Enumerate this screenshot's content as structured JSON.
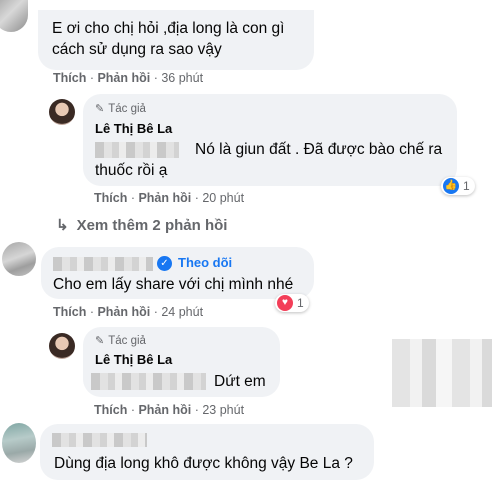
{
  "comment1": {
    "text": "E ơi cho chị hỏi ,địa long là con gì cách sử dụng ra sao vậy",
    "like": "Thích",
    "reply": "Phản hồi",
    "time": "36 phút"
  },
  "reply1": {
    "author_tag": "Tác giả",
    "author_name": "Lê Thị Bê La",
    "text": "Nó là giun đất . Đã được bào chế ra thuốc rồi ạ",
    "like": "Thích",
    "reply": "Phản hồi",
    "time": "20 phút",
    "reaction_count": "1",
    "reaction_icon": "like-icon"
  },
  "more_replies": {
    "label": "Xem thêm 2 phản hồi"
  },
  "comment2": {
    "follow": "Theo dõi",
    "text": "Cho em lấy share với chị mình nhé",
    "like": "Thích",
    "reply": "Phản hồi",
    "time": "24 phút",
    "reaction_count": "1",
    "reaction_icon": "love-icon"
  },
  "reply2": {
    "author_tag": "Tác giả",
    "author_name": "Lê Thị Bê La",
    "text": "Dứt em",
    "like": "Thích",
    "reply": "Phản hồi",
    "time": "23 phút"
  },
  "comment3": {
    "text": "Dùng địa long khô được không vậy Be La ?"
  },
  "colors": {
    "bubble": "#f0f2f5",
    "meta": "#65676b",
    "link": "#1877f2",
    "love": "#f33e58"
  }
}
